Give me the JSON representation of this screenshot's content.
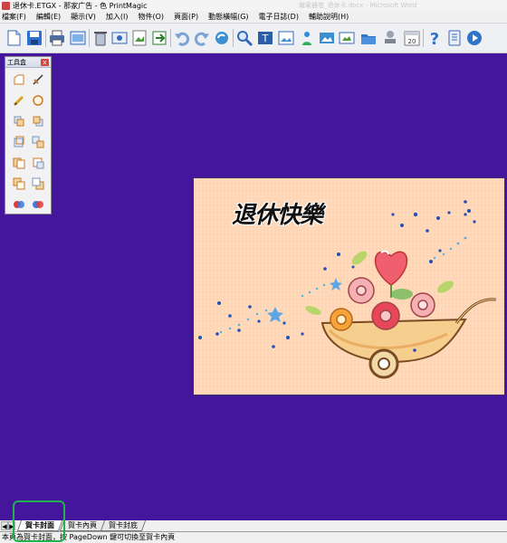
{
  "window": {
    "title": "退休卡.ETGX - 那家广告 - 色 PrintMagic",
    "background_ghost_text": "繼電器卷_退休卡.docx - Microsoft Word"
  },
  "menu": {
    "items": [
      "檔案(F)",
      "編輯(E)",
      "顯示(V)",
      "加入(I)",
      "物件(O)",
      "頁面(P)",
      "動態橫幅(G)",
      "電子日誌(D)",
      "輔助說明(H)"
    ]
  },
  "toolbar": {
    "calendar_badge": "20",
    "icons": [
      "new-icon",
      "save-icon",
      "print-icon",
      "print-preview-icon",
      "delete-icon",
      "import-icon",
      "insert-image-icon",
      "export-icon",
      "undo-icon",
      "redo-icon",
      "refresh-icon",
      "zoom-icon",
      "text-tool-icon",
      "picture-frame-icon",
      "clipart-icon",
      "photo-icon",
      "photo-edit-icon",
      "folder-icon",
      "stamp-icon",
      "calendar-icon",
      "help-icon",
      "info-icon",
      "play-icon"
    ]
  },
  "toolbox": {
    "title": "工具盒",
    "close": "x",
    "tools": [
      "shape-icon",
      "line-icon",
      "pen-icon",
      "ellipse-icon",
      "bring-front-icon",
      "send-back-icon",
      "group-icon",
      "ungroup-icon",
      "copy-icon",
      "paste-icon",
      "layer-front-icon",
      "layer-back-icon",
      "align-icon",
      "distribute-icon"
    ]
  },
  "card": {
    "title": "退休快樂",
    "accent_color": "#ffd9b9"
  },
  "workspace": {
    "background_color": "#44169b"
  },
  "tabs": {
    "scroll_left": "◀",
    "scroll_right": "▶",
    "items": [
      "賀卡封面",
      "賀卡內頁",
      "賀卡封底"
    ],
    "active_index": 0
  },
  "status": {
    "text": "本頁為賀卡封面，按 PageDown 鍵可切換至賀卡內頁"
  },
  "highlight_color": "#22b14c"
}
